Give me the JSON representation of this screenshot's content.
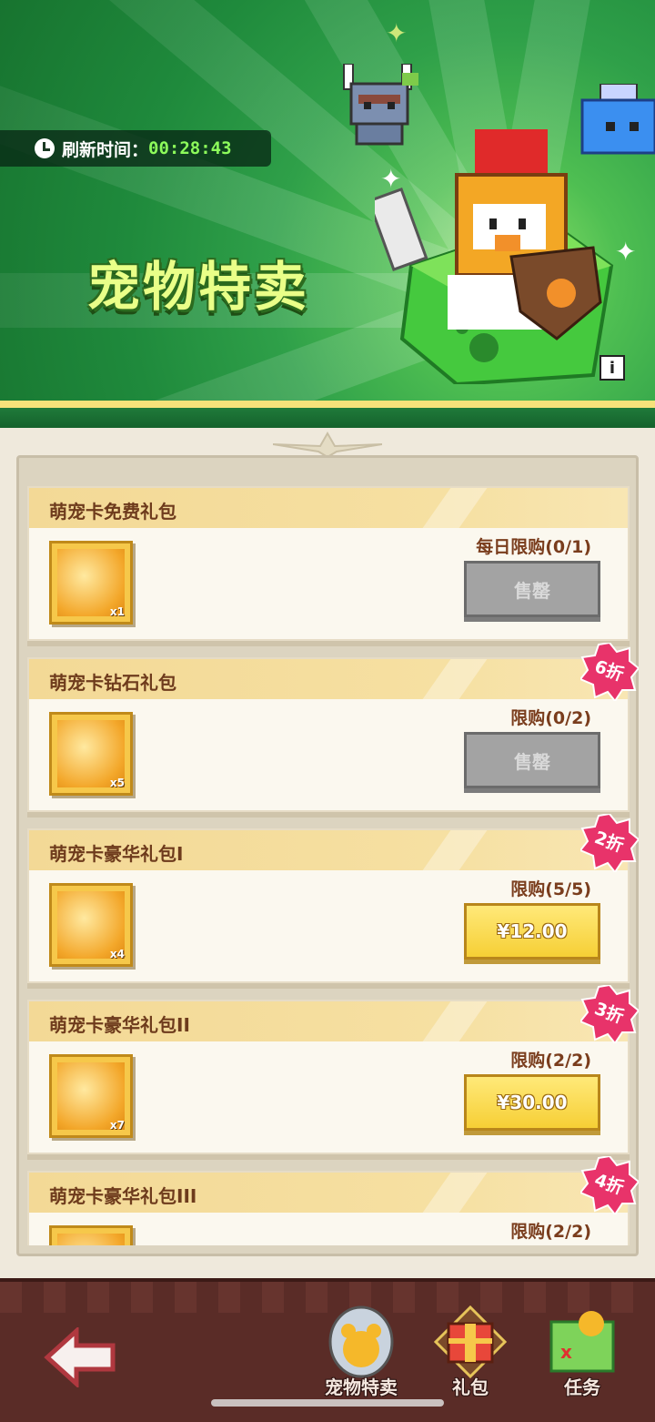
{
  "banner": {
    "timer_label": "刷新时间：",
    "timer_value": "00:28:43",
    "title": "宠物特卖",
    "info_icon": "info-icon"
  },
  "packages": [
    {
      "title": "萌宠卡免费礼包",
      "qty": "x1",
      "limit": "每日限购(0/1)",
      "button": "售罄",
      "state": "sold_out",
      "discount": ""
    },
    {
      "title": "萌宠卡钻石礼包",
      "qty": "x5",
      "limit": "限购(0/2)",
      "button": "售罄",
      "state": "sold_out",
      "discount": "6折"
    },
    {
      "title": "萌宠卡豪华礼包I",
      "qty": "x4",
      "limit": "限购(5/5)",
      "button": "¥12.00",
      "state": "buy",
      "discount": "2折"
    },
    {
      "title": "萌宠卡豪华礼包II",
      "qty": "x7",
      "limit": "限购(2/2)",
      "button": "¥30.00",
      "state": "buy",
      "discount": "3折"
    },
    {
      "title": "萌宠卡豪华礼包III",
      "qty": "",
      "limit": "限购(2/2)",
      "button": "",
      "state": "buy",
      "discount": "4折"
    }
  ],
  "nav": {
    "back_icon": "back-arrow-icon",
    "items": [
      {
        "label": "宠物特卖",
        "icon": "pet-sale-icon"
      },
      {
        "label": "礼包",
        "icon": "gift-chest-icon"
      },
      {
        "label": "任务",
        "icon": "task-map-icon"
      }
    ]
  },
  "colors": {
    "banner_green": "#2fa049",
    "title_text": "#6e3b1c",
    "price_button": "#f6cf35",
    "sold_button": "#a3a3a3",
    "discount_badge": "#e8336a",
    "bottom_bar": "#5a2c27"
  }
}
